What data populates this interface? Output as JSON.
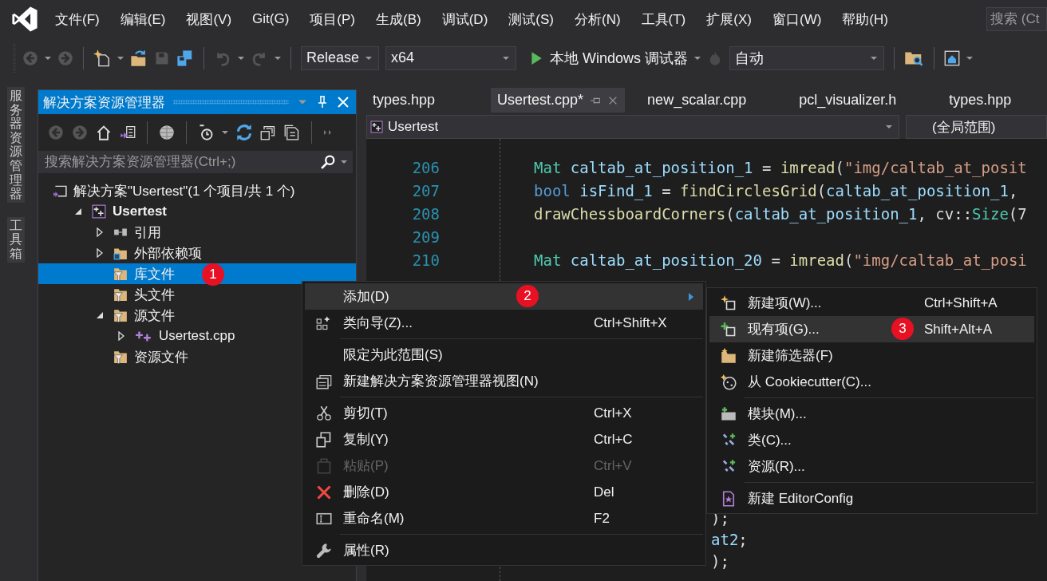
{
  "menu_bar": {
    "items": [
      "文件(F)",
      "编辑(E)",
      "视图(V)",
      "Git(G)",
      "项目(P)",
      "生成(B)",
      "调试(D)",
      "测试(S)",
      "分析(N)",
      "工具(T)",
      "扩展(X)",
      "窗口(W)",
      "帮助(H)"
    ],
    "search": {
      "placeholder": "搜索 (Ct"
    }
  },
  "toolbar": {
    "configuration": "Release",
    "platform": "x64",
    "run_label": "本地 Windows 调试器",
    "mode": "自动"
  },
  "side_strip": [
    "服务器资源管理器",
    "工具箱"
  ],
  "solution_explorer": {
    "title": "解决方案资源管理器",
    "search": {
      "placeholder": "搜索解决方案资源管理器(Ctrl+;)"
    },
    "tree": [
      {
        "label": "解决方案\"Usertest\"(1 个项目/共 1 个)",
        "kind": "solution",
        "selected": false,
        "children": [
          {
            "label": "Usertest",
            "kind": "project",
            "expanded": true,
            "selected": false,
            "children": [
              {
                "label": "引用",
                "kind": "references",
                "expanded": false,
                "selected": false
              },
              {
                "label": "外部依赖项",
                "kind": "external",
                "expanded": false,
                "selected": false
              },
              {
                "label": "库文件",
                "kind": "filter",
                "selected": true,
                "badge": "1"
              },
              {
                "label": "头文件",
                "kind": "filter",
                "selected": false
              },
              {
                "label": "源文件",
                "kind": "filter",
                "expanded": true,
                "selected": false,
                "children": [
                  {
                    "label": "Usertest.cpp",
                    "kind": "cpp",
                    "expanded": false,
                    "selected": false
                  }
                ]
              },
              {
                "label": "资源文件",
                "kind": "filter",
                "selected": false
              }
            ]
          }
        ]
      }
    ]
  },
  "editor": {
    "tabs": [
      {
        "label": "types.hpp",
        "selected": false
      },
      {
        "label": "Usertest.cpp*",
        "selected": true
      },
      {
        "label": "new_scalar.cpp",
        "selected": false
      },
      {
        "label": "pcl_visualizer.h",
        "selected": false
      },
      {
        "label": "types.hpp",
        "selected": false
      }
    ],
    "nav": {
      "project": "Usertest",
      "scope": "(全局范围)"
    },
    "lines": [
      {
        "number": "206",
        "tokens": [
          {
            "text": "Mat",
            "kind": "type"
          },
          {
            "text": " caltab_at_position_1",
            "kind": "var"
          },
          {
            "text": " = ",
            "kind": "plain"
          },
          {
            "text": "imread",
            "kind": "func"
          },
          {
            "text": "(",
            "kind": "plain"
          },
          {
            "text": "\"img/caltab_at_posit",
            "kind": "string"
          }
        ]
      },
      {
        "number": "207",
        "tokens": [
          {
            "text": "bool",
            "kind": "keyword"
          },
          {
            "text": " isFind_1",
            "kind": "var"
          },
          {
            "text": " = ",
            "kind": "plain"
          },
          {
            "text": "findCirclesGrid",
            "kind": "func"
          },
          {
            "text": "(",
            "kind": "plain"
          },
          {
            "text": "caltab_at_position_1",
            "kind": "var"
          },
          {
            "text": ",",
            "kind": "plain"
          }
        ]
      },
      {
        "number": "208",
        "tokens": [
          {
            "text": "drawChessboardCorners",
            "kind": "func"
          },
          {
            "text": "(",
            "kind": "plain"
          },
          {
            "text": "caltab_at_position_1",
            "kind": "var"
          },
          {
            "text": ", cv::",
            "kind": "plain"
          },
          {
            "text": "Size",
            "kind": "type"
          },
          {
            "text": "(7",
            "kind": "plain"
          }
        ]
      },
      {
        "number": "209"
      },
      {
        "number": "210",
        "tokens": [
          {
            "text": "Mat",
            "kind": "type"
          },
          {
            "text": " caltab_at_position_20",
            "kind": "var"
          },
          {
            "text": " = ",
            "kind": "plain"
          },
          {
            "text": "imread",
            "kind": "func"
          },
          {
            "text": "(",
            "kind": "plain"
          },
          {
            "text": "\"img/caltab_at_posi",
            "kind": "string"
          }
        ]
      }
    ],
    "fragments": [
      [
        {
          "text": ");",
          "kind": "plain"
        }
      ],
      [
        {
          "text": "at2",
          "kind": "var"
        },
        {
          "text": ";",
          "kind": "plain"
        }
      ],
      [
        {
          "text": ");",
          "kind": "plain"
        }
      ]
    ]
  },
  "context_menu": {
    "items": [
      {
        "kind": "item",
        "label": "添加(D)",
        "submenu": true,
        "highlighted": true,
        "disabled": false,
        "badge": "2"
      },
      {
        "kind": "item",
        "label": "类向导(Z)...",
        "shortcut": "Ctrl+Shift+X",
        "highlighted": false,
        "disabled": false
      },
      {
        "kind": "separator"
      },
      {
        "kind": "item",
        "label": "限定为此范围(S)",
        "highlighted": false,
        "disabled": false
      },
      {
        "kind": "item",
        "label": "新建解决方案资源管理器视图(N)",
        "highlighted": false,
        "disabled": false
      },
      {
        "kind": "separator"
      },
      {
        "kind": "item",
        "label": "剪切(T)",
        "shortcut": "Ctrl+X",
        "highlighted": false,
        "disabled": false
      },
      {
        "kind": "item",
        "label": "复制(Y)",
        "shortcut": "Ctrl+C",
        "highlighted": false,
        "disabled": false
      },
      {
        "kind": "item",
        "label": "粘贴(P)",
        "shortcut": "Ctrl+V",
        "highlighted": false,
        "disabled": true
      },
      {
        "kind": "item",
        "label": "删除(D)",
        "shortcut": "Del",
        "highlighted": false,
        "disabled": false
      },
      {
        "kind": "item",
        "label": "重命名(M)",
        "shortcut": "F2",
        "highlighted": false,
        "disabled": false
      },
      {
        "kind": "separator"
      },
      {
        "kind": "item",
        "label": "属性(R)",
        "highlighted": false,
        "disabled": false
      }
    ]
  },
  "submenu": {
    "items": [
      {
        "kind": "item",
        "label": "新建项(W)...",
        "shortcut": "Ctrl+Shift+A",
        "highlighted": false,
        "disabled": false
      },
      {
        "kind": "item",
        "label": "现有项(G)...",
        "shortcut": "Shift+Alt+A",
        "highlighted": true,
        "disabled": false,
        "badge": "3"
      },
      {
        "kind": "item",
        "label": "新建筛选器(F)",
        "highlighted": false,
        "disabled": false
      },
      {
        "kind": "item",
        "label": "从 Cookiecutter(C)...",
        "highlighted": false,
        "disabled": false
      },
      {
        "kind": "separator"
      },
      {
        "kind": "item",
        "label": "模块(M)...",
        "highlighted": false,
        "disabled": false
      },
      {
        "kind": "item",
        "label": "类(C)...",
        "highlighted": false,
        "disabled": false
      },
      {
        "kind": "item",
        "label": "资源(R)...",
        "highlighted": false,
        "disabled": false
      },
      {
        "kind": "separator"
      },
      {
        "kind": "item",
        "label": "新建 EditorConfig",
        "highlighted": false,
        "disabled": false
      }
    ]
  }
}
